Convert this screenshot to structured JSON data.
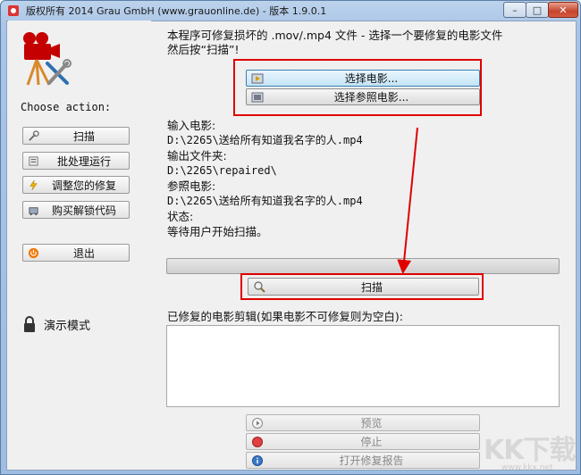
{
  "window": {
    "title": "版权所有 2014 Grau GmbH (www.grauonline.de) - 版本 1.9.0.1",
    "minimize_glyph": "–",
    "maximize_glyph": "□",
    "close_glyph": "✕"
  },
  "sidebar": {
    "choose_label": "Choose action:",
    "buttons": [
      {
        "label": "扫描",
        "icon": "wrench-icon"
      },
      {
        "label": "批处理运行",
        "icon": "batch-icon"
      },
      {
        "label": "调整您的修复",
        "icon": "lightning-icon"
      },
      {
        "label": "购买解锁代码",
        "icon": "cart-icon"
      },
      {
        "label": "退出",
        "icon": "power-icon"
      }
    ],
    "demo_label": "演示模式"
  },
  "main": {
    "intro_line1": "本程序可修复损坏的 .mov/.mp4 文件 - 选择一个要修复的电影文件",
    "intro_line2": "然后按“扫描”!",
    "select_movie_label": "选择电影...",
    "select_ref_label": "选择参照电影...",
    "input_movie_label": "输入电影:",
    "input_movie_value": "D:\\2265\\送给所有知道我名字的人.mp4",
    "output_folder_label": "输出文件夹:",
    "output_folder_value": "D:\\2265\\repaired\\",
    "ref_movie_label": "参照电影:",
    "ref_movie_value": "D:\\2265\\送给所有知道我名字的人.mp4",
    "status_label": "状态:",
    "status_value": "等待用户开始扫描。",
    "scan_label": "扫描",
    "repaired_label": "已修复的电影剪辑(如果电影不可修复则为空白):",
    "preview_label": "预览",
    "stop_label": "停止",
    "report_label": "打开修复报告",
    "progress": 0
  },
  "watermark": {
    "text": "KK下载",
    "url": "www.kkx.net"
  },
  "colors": {
    "highlight_red": "#e00000",
    "title_bar": "#bcd3ec"
  }
}
